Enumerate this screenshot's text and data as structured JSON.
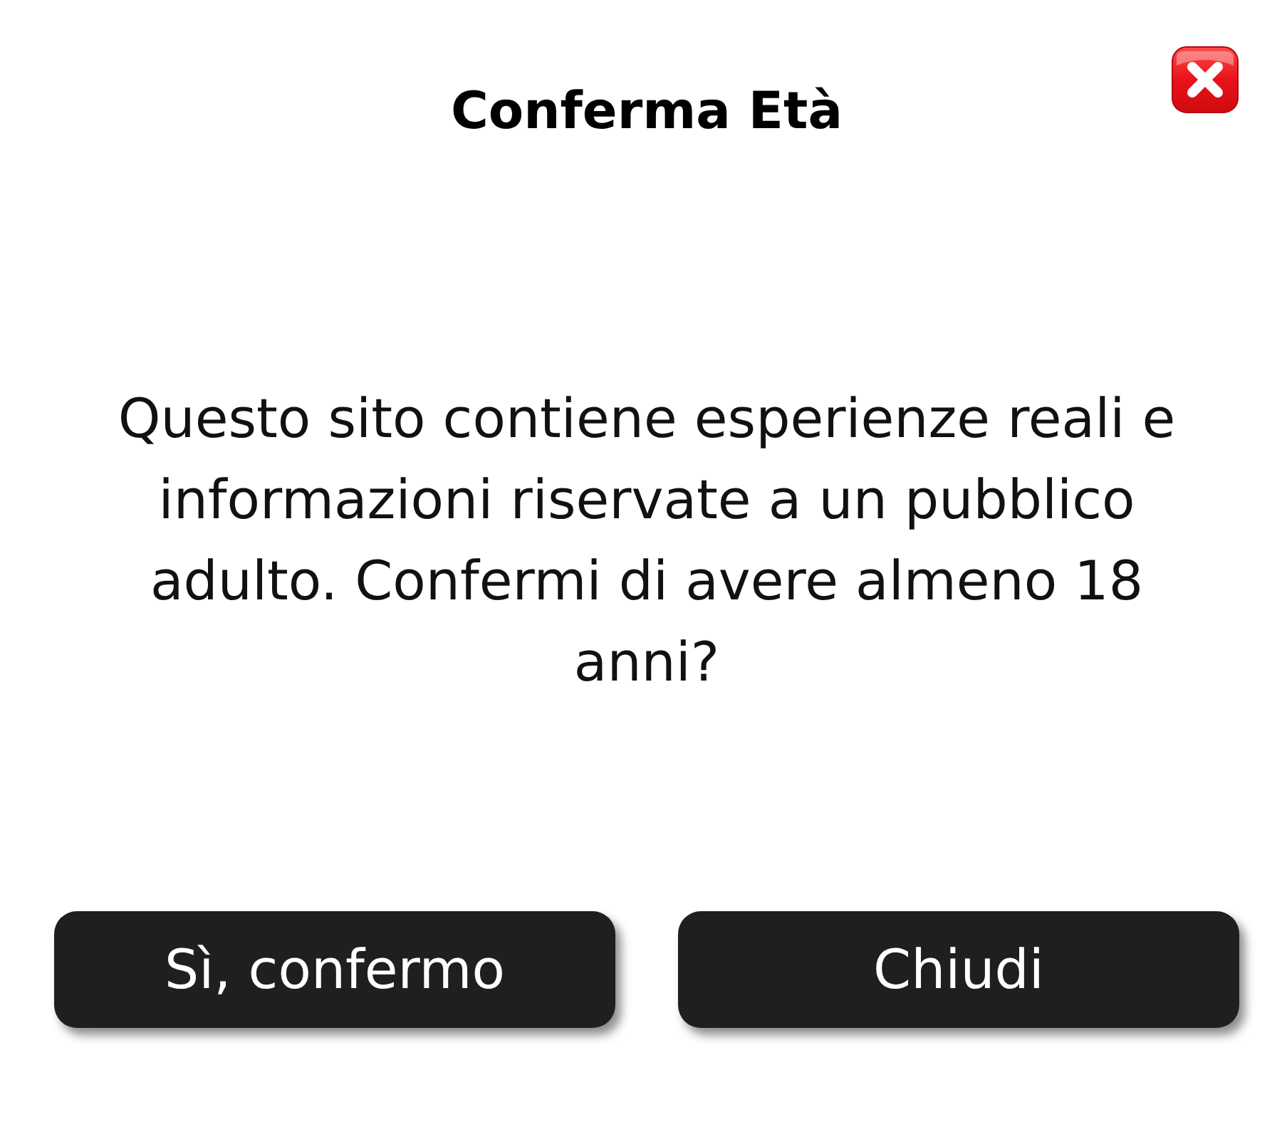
{
  "dialog": {
    "title": "Conferma Età",
    "message": "Questo sito contiene esperienze reali e informazioni riservate a un pubblico adulto. Confermi di avere almeno 18 anni?",
    "buttons": [
      "Sì, confermo",
      "Chiudi"
    ]
  }
}
